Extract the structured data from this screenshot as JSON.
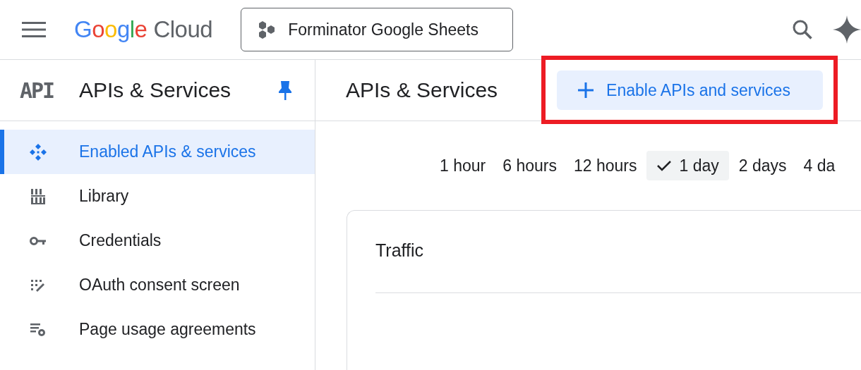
{
  "topbar": {
    "logo": {
      "brand": "Google",
      "product": "Cloud"
    },
    "project": "Forminator Google Sheets"
  },
  "sidebar": {
    "badge": "API",
    "title": "APIs & Services",
    "pinned": true,
    "items": [
      {
        "label": "Enabled APIs & services",
        "kind": "enabled",
        "selected": true
      },
      {
        "label": "Library",
        "kind": "library",
        "selected": false
      },
      {
        "label": "Credentials",
        "kind": "key",
        "selected": false
      },
      {
        "label": "OAuth consent screen",
        "kind": "consent",
        "selected": false
      },
      {
        "label": "Page usage agreements",
        "kind": "agreements",
        "selected": false
      }
    ]
  },
  "main": {
    "title": "APIs & Services",
    "action": {
      "label": "Enable APIs and services",
      "highlighted": true
    },
    "time_ranges": [
      {
        "label": "1 hour",
        "selected": false
      },
      {
        "label": "6 hours",
        "selected": false
      },
      {
        "label": "12 hours",
        "selected": false
      },
      {
        "label": "1 day",
        "selected": true
      },
      {
        "label": "2 days",
        "selected": false
      },
      {
        "label": "4 da",
        "selected": false
      }
    ],
    "card": {
      "title": "Traffic"
    }
  }
}
